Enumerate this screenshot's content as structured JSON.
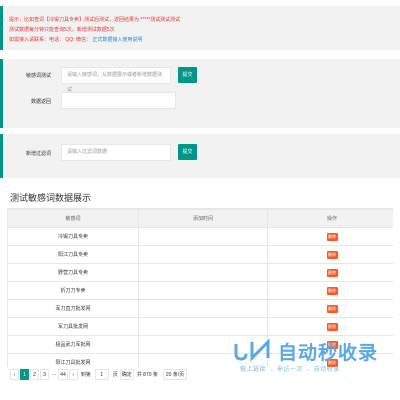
{
  "notice": {
    "line1": "提示：比如查词【冷锻刀具专卖】测试后测试，返回结果为 *****测试测试测试",
    "line2": "测试数据每分钟只能查询5次，新增测试数据5次",
    "line3_prefix": "如需接入请联系：电话： QQ: 微信：",
    "line3_link": "正式数据接入使用说明"
  },
  "test_form": {
    "label": "敏感词测试",
    "placeholder": "请输入敏感词，从数据展示或者新增数据测试",
    "submit": "提交",
    "result_label": "数据返回"
  },
  "add_form": {
    "label": "新增过滤词",
    "placeholder": "请输入过滤词数据",
    "submit": "提交"
  },
  "section_title": "测试敏感词数据展示",
  "table": {
    "headers": [
      "敏感词",
      "添加时间",
      "操作"
    ],
    "rows": [
      {
        "word": "冷锻刀具专卖",
        "time": ""
      },
      {
        "word": "阳江刀具专卖",
        "time": ""
      },
      {
        "word": "野营刀具专卖",
        "time": ""
      },
      {
        "word": "折刀刀专卖",
        "time": ""
      },
      {
        "word": "军刀直刀批发网",
        "time": ""
      },
      {
        "word": "军刀具批发网",
        "time": ""
      },
      {
        "word": "极品武力军批网",
        "time": ""
      },
      {
        "word": "阳江刀具批发网",
        "time": ""
      }
    ],
    "delete_label": "删除"
  },
  "pager": {
    "prev": "‹",
    "pages": [
      "1",
      "2",
      "3",
      "...",
      "44"
    ],
    "next": "›",
    "goto_prefix": "到第",
    "goto_value": "1",
    "goto_suffix": "页",
    "confirm": "确定",
    "total": "共 870 条",
    "page_size": "20 条/页"
  },
  "watermark": {
    "main": "自动秒收录",
    "sub": "做上链接 → 来访一次 → 自动收录"
  }
}
